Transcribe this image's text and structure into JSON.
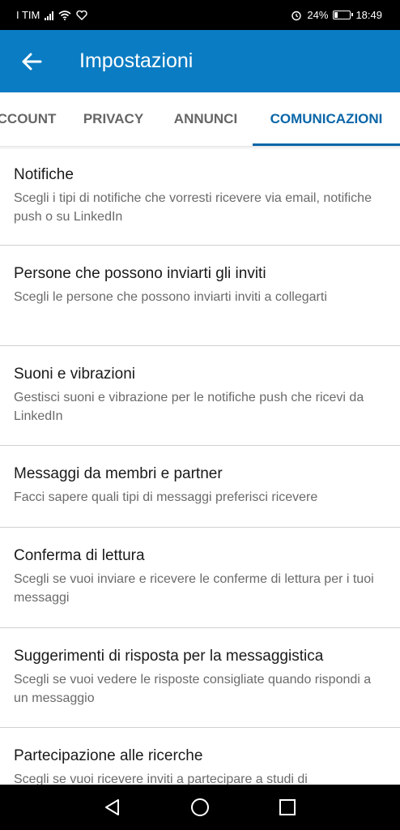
{
  "status_bar": {
    "carrier": "I TIM",
    "battery_percent": "24%",
    "battery_level": 0.24,
    "time": "18:49",
    "icons": [
      "signal-icon",
      "wifi-icon",
      "heart-icon",
      "alarm-icon",
      "battery-icon"
    ]
  },
  "app_bar": {
    "title": "Impostazioni",
    "back_icon": "arrow-left-icon"
  },
  "tabs": [
    {
      "label": "CCOUNT",
      "active": false
    },
    {
      "label": "PRIVACY",
      "active": false
    },
    {
      "label": "ANNUNCI",
      "active": false
    },
    {
      "label": "COMUNICAZIONI",
      "active": true
    }
  ],
  "colors": {
    "app_bar": "#0a7cc3",
    "active_tab": "#0a66a8"
  },
  "items": [
    {
      "title": "Notifiche",
      "desc": "Scegli i tipi di notifiche che vorresti ricevere via email, notifiche push o su LinkedIn"
    },
    {
      "title": "Persone che possono inviarti gli inviti",
      "desc": "Scegli le persone che possono inviarti inviti a collegarti"
    },
    {
      "title": "Suoni e vibrazioni",
      "desc": "Gestisci suoni e vibrazione per le notifiche push che ricevi da LinkedIn"
    },
    {
      "title": "Messaggi da membri e partner",
      "desc": "Facci sapere quali tipi di messaggi preferisci ricevere"
    },
    {
      "title": "Conferma di lettura",
      "desc": "Scegli se vuoi inviare e ricevere le conferme di lettura per i tuoi messaggi"
    },
    {
      "title": "Suggerimenti di risposta per la messaggistica",
      "desc": "Scegli se vuoi vedere le risposte consigliate quando rispondi a un messaggio"
    },
    {
      "title": "Partecipazione alle ricerche",
      "desc": "Scegli se vuoi ricevere inviti a partecipare a studi di"
    }
  ],
  "nav_bar": {
    "buttons": [
      "back-triangle-icon",
      "home-circle-icon",
      "recents-square-icon"
    ]
  }
}
